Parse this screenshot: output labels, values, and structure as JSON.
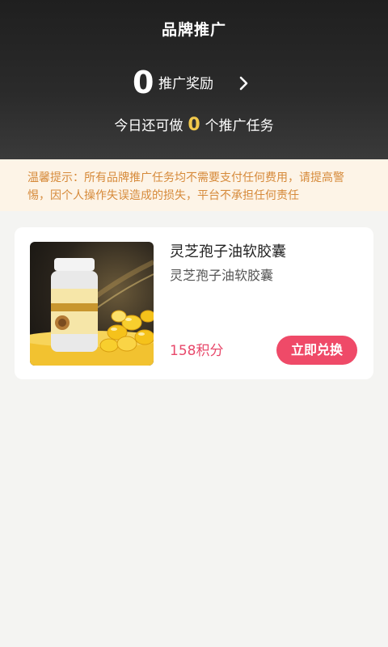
{
  "header": {
    "title": "品牌推广",
    "reward_count": "0",
    "reward_label": "推广奖励",
    "tasks_prefix": "今日还可做",
    "tasks_count": "0",
    "tasks_suffix": "个推广任务"
  },
  "notice": {
    "text": "温馨提示：所有品牌推广任务均不需要支付任何费用，请提高警惕，因个人操作失误造成的损失，平台不承担任何责任"
  },
  "products": [
    {
      "title": "灵芝孢子油软胶囊",
      "subtitle": "灵芝孢子油软胶囊",
      "price": "158积分",
      "button_label": "立即兑换",
      "image_label": "灵芝孢子油软胶囊"
    }
  ],
  "colors": {
    "accent": "#ef4a68",
    "price": "#e8496b",
    "notice_text": "#d68a3a",
    "notice_bg": "#fdf4e7",
    "highlight": "#f2c94c"
  }
}
